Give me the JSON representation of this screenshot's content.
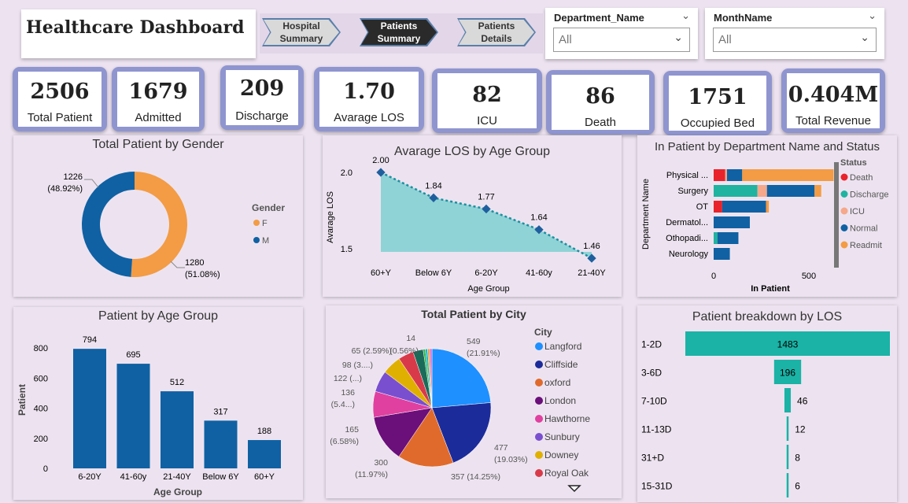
{
  "header": {
    "title": "Healthcare Dashboard"
  },
  "nav": {
    "tabs": [
      {
        "l1": "Hospital",
        "l2": "Summary"
      },
      {
        "l1": "Patients",
        "l2": "Summary"
      },
      {
        "l1": "Patients",
        "l2": "Details"
      }
    ]
  },
  "slicers": [
    {
      "label": "Department_Name",
      "value": "All"
    },
    {
      "label": "MonthName",
      "value": "All"
    }
  ],
  "kpis": [
    {
      "value": "2506",
      "caption": "Total Patient"
    },
    {
      "value": "1679",
      "caption": "Admitted"
    },
    {
      "value": "209",
      "caption": "Discharge"
    },
    {
      "value": "1.70",
      "caption": "Avarage LOS"
    },
    {
      "value": "82",
      "caption": "ICU"
    },
    {
      "value": "86",
      "caption": "Death"
    },
    {
      "value": "1751",
      "caption": "Occupied Bed"
    },
    {
      "value": "0.404M",
      "caption": "Total Revenue"
    }
  ],
  "chart_data": [
    {
      "type": "pie",
      "title": "Total Patient by Gender",
      "legend_title": "Gender",
      "legend_position": "right",
      "slices": [
        {
          "name": "F",
          "value": 1280,
          "pct": "51.08%",
          "color": "#f39c45"
        },
        {
          "name": "M",
          "value": 1226,
          "pct": "48.92%",
          "color": "#0f61a3"
        }
      ]
    },
    {
      "type": "area",
      "title": "Avarage LOS by Age Group",
      "xlabel": "Age Group",
      "ylabel": "Avarage LOS",
      "categories": [
        "60+Y",
        "Below 6Y",
        "6-20Y",
        "41-60y",
        "21-40Y"
      ],
      "values": [
        2.0,
        1.84,
        1.77,
        1.64,
        1.46
      ],
      "yticks": [
        "2.0",
        "1.5"
      ],
      "ylim": [
        1.5,
        2.0
      ],
      "color": "#1b8fa0"
    },
    {
      "type": "bar",
      "orientation": "horizontal",
      "stacked": true,
      "title": "In Patient by Department Name and Status",
      "xlabel": "In Patient",
      "ylabel": "Department Name",
      "categories": [
        "Physical ...",
        "Surgery",
        "OT",
        "Dermatol...",
        "Othopadi...",
        "Neurology"
      ],
      "xticks": [
        "0",
        "500"
      ],
      "xlim": [
        0,
        650
      ],
      "legend_title": "Status",
      "legend_position": "right",
      "series": [
        {
          "name": "Death",
          "color": "#e8232b",
          "values": [
            60,
            0,
            45,
            0,
            0,
            0
          ]
        },
        {
          "name": "Discharge",
          "color": "#1fb3a0",
          "values": [
            0,
            230,
            0,
            0,
            20,
            0
          ]
        },
        {
          "name": "ICU",
          "color": "#f5a88b",
          "values": [
            10,
            50,
            0,
            0,
            0,
            0
          ]
        },
        {
          "name": "Normal",
          "color": "#0f61a3",
          "values": [
            80,
            250,
            230,
            190,
            110,
            85
          ]
        },
        {
          "name": "Readmit",
          "color": "#f39c45",
          "values": [
            480,
            35,
            15,
            0,
            0,
            0
          ]
        }
      ]
    },
    {
      "type": "bar",
      "title": "Patient by Age Group",
      "xlabel": "Age Group",
      "ylabel": "Patient",
      "categories": [
        "6-20Y",
        "41-60y",
        "21-40Y",
        "Below 6Y",
        "60+Y"
      ],
      "values": [
        794,
        695,
        512,
        317,
        188
      ],
      "yticks": [
        "800",
        "600",
        "400",
        "200",
        "0"
      ],
      "ylim": [
        0,
        800
      ],
      "color": "#0f61a3"
    },
    {
      "type": "pie",
      "title": "Total Patient by City",
      "legend_title": "City",
      "legend_position": "right",
      "slices": [
        {
          "name": "Langford",
          "value": 549,
          "label": "549",
          "label2": "(21.91%)",
          "color": "#1e90ff"
        },
        {
          "name": "Cliffside",
          "value": 477,
          "label": "477",
          "label2": "(19.03%)",
          "color": "#1c2b9a"
        },
        {
          "name": "oxford",
          "value": 357,
          "label": "357 (14.25%)",
          "label2": "",
          "color": "#e06a2c"
        },
        {
          "name": "London",
          "value": 300,
          "label": "300",
          "label2": "(11.97%)",
          "color": "#6b0f7a"
        },
        {
          "name": "Hawthorne",
          "value": 165,
          "label": "165",
          "label2": "(6.58%)",
          "color": "#e0409f"
        },
        {
          "name": "Sunbury",
          "value": 136,
          "label": "136",
          "label2": "(5.4...)",
          "color": "#7a4fcf"
        },
        {
          "name": "Downey",
          "value": 122,
          "label": "122 (...)",
          "label2": "",
          "color": "#e0b000"
        },
        {
          "name": "Royal Oak",
          "value": 98,
          "label": "98 (3....)",
          "label2": "",
          "color": "#d93a4a"
        },
        {
          "name": "",
          "value": 65,
          "label": "65 (2.59%)",
          "label2": "",
          "color": "#1a6b5a"
        },
        {
          "name": "",
          "value": 14,
          "label": "(0.56%)",
          "label2": "",
          "color": "#2ab34a"
        },
        {
          "name": "",
          "value": 14,
          "label": "",
          "label2": "",
          "color": "#11b5c8"
        },
        {
          "name": "",
          "value": 14,
          "label": "14",
          "label2": "",
          "color": "#f39c45"
        },
        {
          "name": "",
          "value": 14,
          "label": "",
          "label2": "",
          "color": "#c86bd6"
        }
      ]
    },
    {
      "type": "bar",
      "orientation": "horizontal",
      "title": "Patient breakdown by LOS",
      "categories": [
        "1-2D",
        "3-6D",
        "7-10D",
        "11-13D",
        "31+D",
        "15-31D"
      ],
      "values": [
        1483,
        196,
        46,
        12,
        8,
        6
      ],
      "color": "#1ab3a6"
    }
  ]
}
